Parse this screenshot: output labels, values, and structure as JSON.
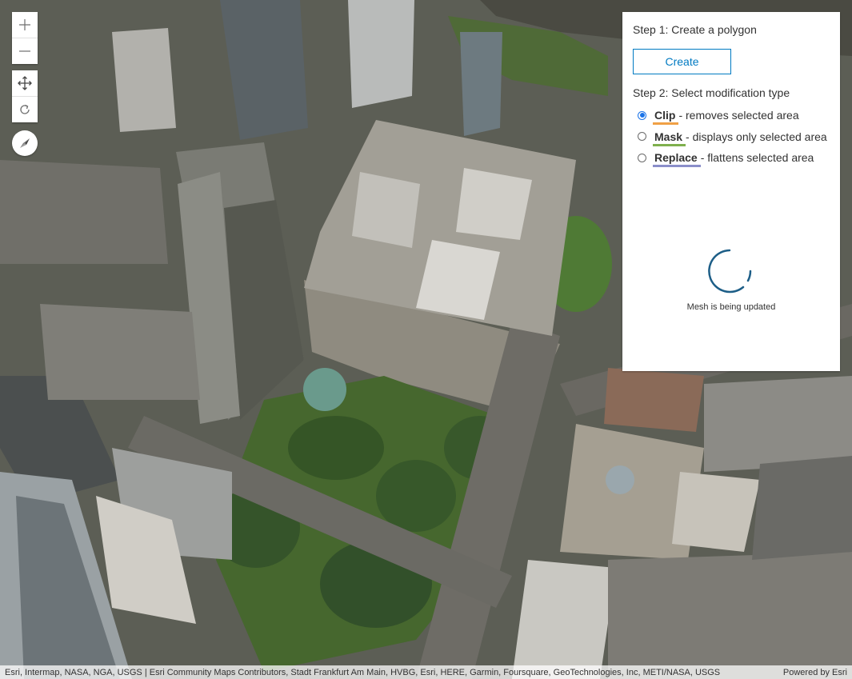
{
  "panel": {
    "step1_label": "Step 1: Create a polygon",
    "create_button": "Create",
    "step2_label": "Step 2: Select modification type",
    "options": [
      {
        "name": "Clip",
        "description": "- removes selected area",
        "selected": true,
        "underline_color": "#f0a045"
      },
      {
        "name": "Mask",
        "description": "- displays only selected area",
        "selected": false,
        "underline_color": "#7fb04d"
      },
      {
        "name": "Replace",
        "description": "- flattens selected area",
        "selected": false,
        "underline_color": "#8a8ec9"
      }
    ],
    "loading_text": "Mesh is being updated"
  },
  "navigation": {
    "zoom_in": "zoom-in-icon",
    "zoom_out": "zoom-out-icon",
    "pan": "pan-icon",
    "rotate": "rotate-icon",
    "compass": "compass-icon"
  },
  "attribution": {
    "text": "Esri, Intermap, NASA, NGA, USGS | Esri Community Maps Contributors, Stadt Frankfurt Am Main, HVBG, Esri, HERE, Garmin, Foursquare, GeoTechnologies, Inc, METI/NASA, USGS",
    "powered_by": "Powered by Esri"
  },
  "colors": {
    "accent": "#007ac2",
    "radio_selected": "#1a73e8"
  }
}
